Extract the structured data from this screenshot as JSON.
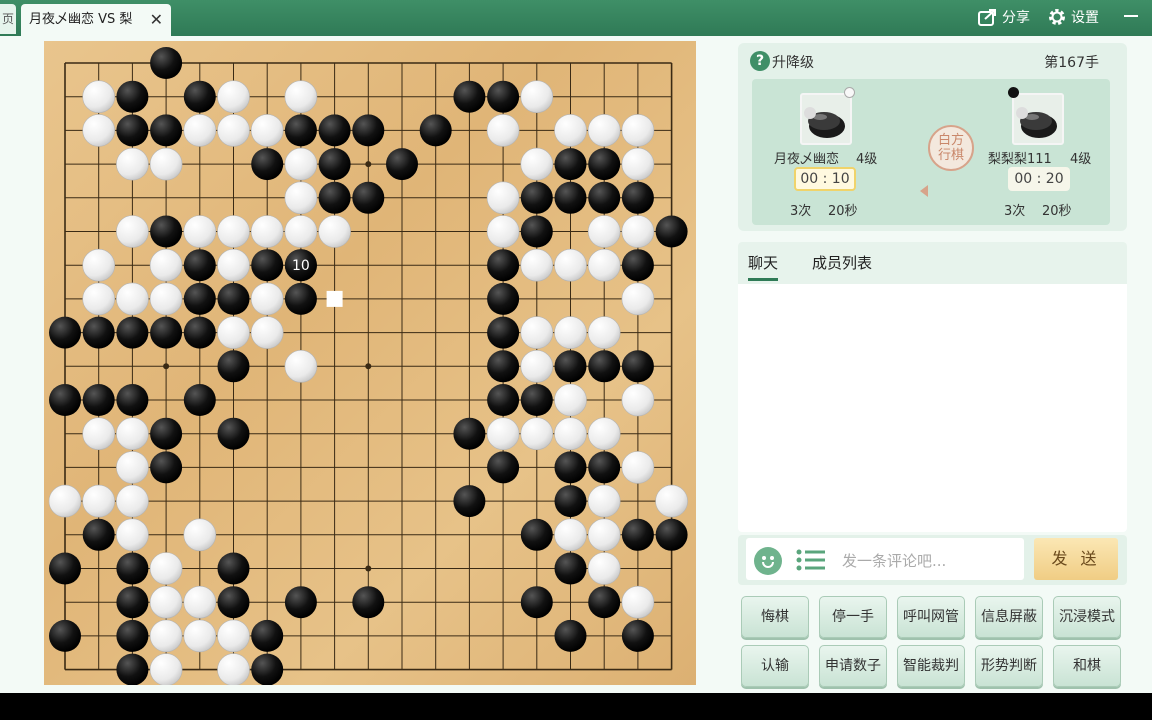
{
  "tabs": {
    "stub_label": "页",
    "active_label": "月夜乄幽恋 VS 梨",
    "close_label": "✕"
  },
  "header_actions": {
    "share_label": "分享",
    "settings_label": "设置"
  },
  "match": {
    "mode_label": "升降级",
    "move_label": "第167手",
    "turn_label_line1": "白方",
    "turn_label_line2": "行棋",
    "players": [
      {
        "name": "月夜乄幽恋",
        "rank": "4级",
        "clock": "00 : 10",
        "byoyomi_count": "3次",
        "byoyomi_time": "20秒",
        "color": "white",
        "active": true
      },
      {
        "name": "梨梨梨111",
        "rank": "4级",
        "clock": "00 : 20",
        "byoyomi_count": "3次",
        "byoyomi_time": "20秒",
        "color": "black",
        "active": false
      }
    ]
  },
  "chat": {
    "tabs": [
      "聊天",
      "成员列表"
    ],
    "placeholder": "发一条评论吧...",
    "send_label": "发 送"
  },
  "buttons": [
    "悔棋",
    "停一手",
    "呼叫网管",
    "信息屏蔽",
    "沉浸模式",
    "认输",
    "申请数子",
    "智能裁判",
    "形势判断",
    "和棋"
  ],
  "colors": {
    "accent": "#2f7a56",
    "board": "#e4bb7f",
    "panel": "#e3f1e9"
  },
  "board": {
    "size": 19,
    "last_move_label": "10",
    "last_move": {
      "x": 7,
      "y": 6
    },
    "marker": {
      "x": 8,
      "y": 7
    },
    "stars": [
      [
        3,
        3
      ],
      [
        9,
        3
      ],
      [
        15,
        3
      ],
      [
        3,
        9
      ],
      [
        9,
        9
      ],
      [
        15,
        9
      ],
      [
        3,
        15
      ],
      [
        9,
        15
      ],
      [
        15,
        15
      ]
    ],
    "black": [
      [
        3,
        0
      ],
      [
        2,
        1
      ],
      [
        4,
        1
      ],
      [
        12,
        1
      ],
      [
        13,
        1
      ],
      [
        2,
        2
      ],
      [
        3,
        2
      ],
      [
        7,
        2
      ],
      [
        8,
        2
      ],
      [
        9,
        2
      ],
      [
        11,
        2
      ],
      [
        6,
        3
      ],
      [
        8,
        3
      ],
      [
        10,
        3
      ],
      [
        15,
        3
      ],
      [
        16,
        3
      ],
      [
        8,
        4
      ],
      [
        9,
        4
      ],
      [
        14,
        4
      ],
      [
        15,
        4
      ],
      [
        16,
        4
      ],
      [
        17,
        4
      ],
      [
        3,
        5
      ],
      [
        14,
        5
      ],
      [
        18,
        5
      ],
      [
        4,
        6
      ],
      [
        6,
        6
      ],
      [
        7,
        6
      ],
      [
        13,
        6
      ],
      [
        17,
        6
      ],
      [
        4,
        7
      ],
      [
        5,
        7
      ],
      [
        7,
        7
      ],
      [
        13,
        7
      ],
      [
        0,
        8
      ],
      [
        1,
        8
      ],
      [
        2,
        8
      ],
      [
        3,
        8
      ],
      [
        4,
        8
      ],
      [
        13,
        8
      ],
      [
        5,
        9
      ],
      [
        13,
        9
      ],
      [
        15,
        9
      ],
      [
        16,
        9
      ],
      [
        17,
        9
      ],
      [
        0,
        10
      ],
      [
        1,
        10
      ],
      [
        2,
        10
      ],
      [
        4,
        10
      ],
      [
        13,
        10
      ],
      [
        14,
        10
      ],
      [
        3,
        11
      ],
      [
        5,
        11
      ],
      [
        12,
        11
      ],
      [
        3,
        12
      ],
      [
        13,
        12
      ],
      [
        15,
        12
      ],
      [
        16,
        12
      ],
      [
        12,
        13
      ],
      [
        15,
        13
      ],
      [
        1,
        14
      ],
      [
        14,
        14
      ],
      [
        17,
        14
      ],
      [
        18,
        14
      ],
      [
        0,
        15
      ],
      [
        2,
        15
      ],
      [
        5,
        15
      ],
      [
        15,
        15
      ],
      [
        2,
        16
      ],
      [
        5,
        16
      ],
      [
        7,
        16
      ],
      [
        9,
        16
      ],
      [
        14,
        16
      ],
      [
        16,
        16
      ],
      [
        0,
        17
      ],
      [
        2,
        17
      ],
      [
        6,
        17
      ],
      [
        15,
        17
      ],
      [
        17,
        17
      ],
      [
        2,
        18
      ],
      [
        6,
        18
      ]
    ],
    "white": [
      [
        1,
        1
      ],
      [
        5,
        1
      ],
      [
        7,
        1
      ],
      [
        14,
        1
      ],
      [
        1,
        2
      ],
      [
        4,
        2
      ],
      [
        5,
        2
      ],
      [
        6,
        2
      ],
      [
        13,
        2
      ],
      [
        15,
        2
      ],
      [
        16,
        2
      ],
      [
        17,
        2
      ],
      [
        2,
        3
      ],
      [
        3,
        3
      ],
      [
        7,
        3
      ],
      [
        14,
        3
      ],
      [
        17,
        3
      ],
      [
        7,
        4
      ],
      [
        13,
        4
      ],
      [
        2,
        5
      ],
      [
        4,
        5
      ],
      [
        5,
        5
      ],
      [
        6,
        5
      ],
      [
        7,
        5
      ],
      [
        8,
        5
      ],
      [
        13,
        5
      ],
      [
        16,
        5
      ],
      [
        17,
        5
      ],
      [
        1,
        6
      ],
      [
        3,
        6
      ],
      [
        5,
        6
      ],
      [
        14,
        6
      ],
      [
        15,
        6
      ],
      [
        16,
        6
      ],
      [
        1,
        7
      ],
      [
        2,
        7
      ],
      [
        3,
        7
      ],
      [
        6,
        7
      ],
      [
        17,
        7
      ],
      [
        5,
        8
      ],
      [
        6,
        8
      ],
      [
        14,
        8
      ],
      [
        15,
        8
      ],
      [
        16,
        8
      ],
      [
        7,
        9
      ],
      [
        14,
        9
      ],
      [
        15,
        10
      ],
      [
        17,
        10
      ],
      [
        1,
        11
      ],
      [
        2,
        11
      ],
      [
        13,
        11
      ],
      [
        14,
        11
      ],
      [
        15,
        11
      ],
      [
        16,
        11
      ],
      [
        2,
        12
      ],
      [
        17,
        12
      ],
      [
        0,
        13
      ],
      [
        1,
        13
      ],
      [
        2,
        13
      ],
      [
        16,
        13
      ],
      [
        18,
        13
      ],
      [
        2,
        14
      ],
      [
        4,
        14
      ],
      [
        15,
        14
      ],
      [
        16,
        14
      ],
      [
        3,
        15
      ],
      [
        16,
        15
      ],
      [
        3,
        16
      ],
      [
        4,
        16
      ],
      [
        17,
        16
      ],
      [
        3,
        17
      ],
      [
        4,
        17
      ],
      [
        5,
        17
      ],
      [
        3,
        18
      ],
      [
        5,
        18
      ]
    ]
  }
}
